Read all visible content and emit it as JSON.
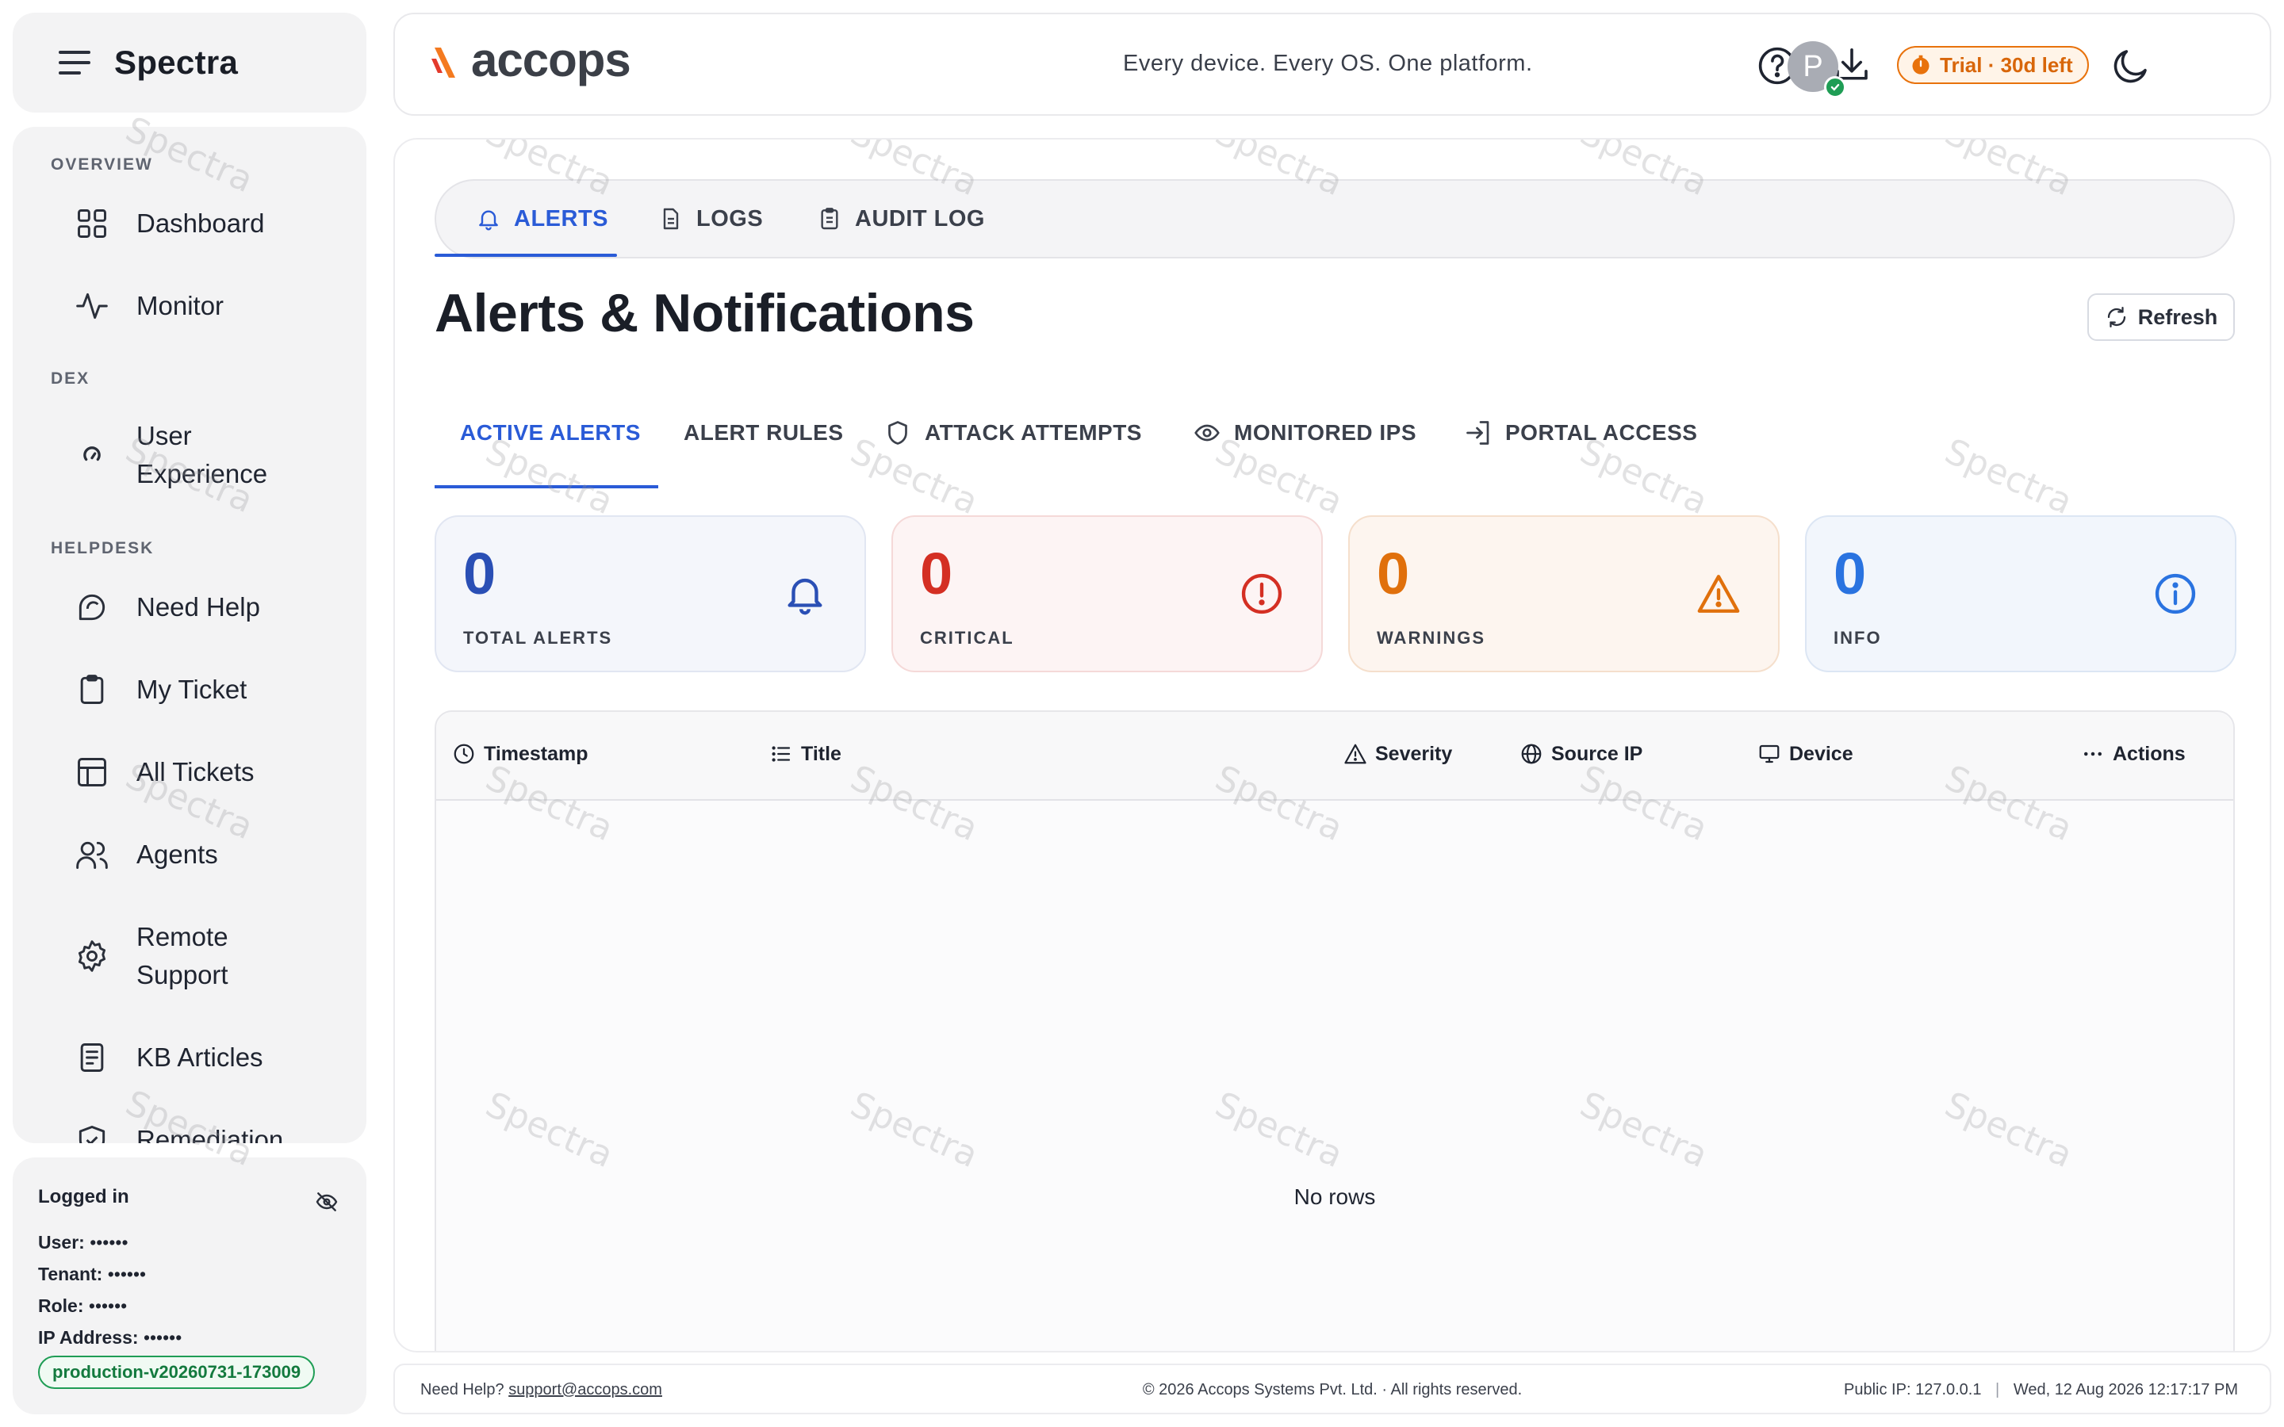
{
  "app": {
    "name": "Spectra"
  },
  "sidebar": {
    "sections": {
      "overview": "OVERVIEW",
      "dex": "DEX",
      "helpdesk": "HELPDESK"
    },
    "items": [
      {
        "label": "Dashboard",
        "icon": "grid-icon"
      },
      {
        "label": "Monitor",
        "icon": "activity-icon"
      },
      {
        "label": "User Experience",
        "icon": "gauge-icon"
      },
      {
        "label": "Need Help",
        "icon": "chat-icon"
      },
      {
        "label": "My Ticket",
        "icon": "clipboard-icon"
      },
      {
        "label": "All Tickets",
        "icon": "table-icon"
      },
      {
        "label": "Agents",
        "icon": "users-icon"
      },
      {
        "label": "Remote Support",
        "icon": "gear-icon"
      },
      {
        "label": "KB Articles",
        "icon": "document-icon"
      },
      {
        "label": "Remediation",
        "icon": "shield-check-icon"
      }
    ]
  },
  "login": {
    "title": "Logged in",
    "user_label": "User:",
    "user_value": "••••••",
    "tenant_label": "Tenant:",
    "tenant_value": "••••••",
    "role_label": "Role:",
    "role_value": "••••••",
    "ip_label": "IP Address:",
    "ip_value": "••••••",
    "version": "production-v20260731-173009"
  },
  "header": {
    "logo_text": "accops",
    "tagline": "Every device. Every OS. One platform.",
    "trial": "Trial · 30d left",
    "avatar_initial": "P"
  },
  "top_tabs": [
    {
      "label": "ALERTS"
    },
    {
      "label": "LOGS"
    },
    {
      "label": "AUDIT LOG"
    }
  ],
  "page": {
    "title": "Alerts & Notifications",
    "refresh": "Refresh"
  },
  "sub_tabs": [
    {
      "label": "ACTIVE ALERTS"
    },
    {
      "label": "ALERT RULES"
    },
    {
      "label": "ATTACK ATTEMPTS"
    },
    {
      "label": "MONITORED IPS"
    },
    {
      "label": "PORTAL ACCESS"
    }
  ],
  "stats": [
    {
      "value": "0",
      "label": "TOTAL ALERTS",
      "color": "#2a4fb5"
    },
    {
      "value": "0",
      "label": "CRITICAL",
      "color": "#d42f23"
    },
    {
      "value": "0",
      "label": "WARNINGS",
      "color": "#e0700c"
    },
    {
      "value": "0",
      "label": "INFO",
      "color": "#2a73e0"
    }
  ],
  "table": {
    "columns": [
      "Timestamp",
      "Title",
      "Severity",
      "Source IP",
      "Device",
      "Actions"
    ],
    "empty": "No rows"
  },
  "footer": {
    "help_prefix": "Need Help?",
    "help_email": "support@accops.com",
    "copyright": "© 2026 Accops Systems Pvt. Ltd. · All rights reserved.",
    "public_ip": "Public IP: 127.0.0.1",
    "datetime": "Wed, 12 Aug 2026 12:17:17 PM"
  },
  "watermark": "Spectra",
  "colors": {
    "accent": "#2a5bd7",
    "critical": "#d42f23",
    "warning": "#e0700c",
    "info": "#2a73e0",
    "success": "#1f9d55"
  }
}
